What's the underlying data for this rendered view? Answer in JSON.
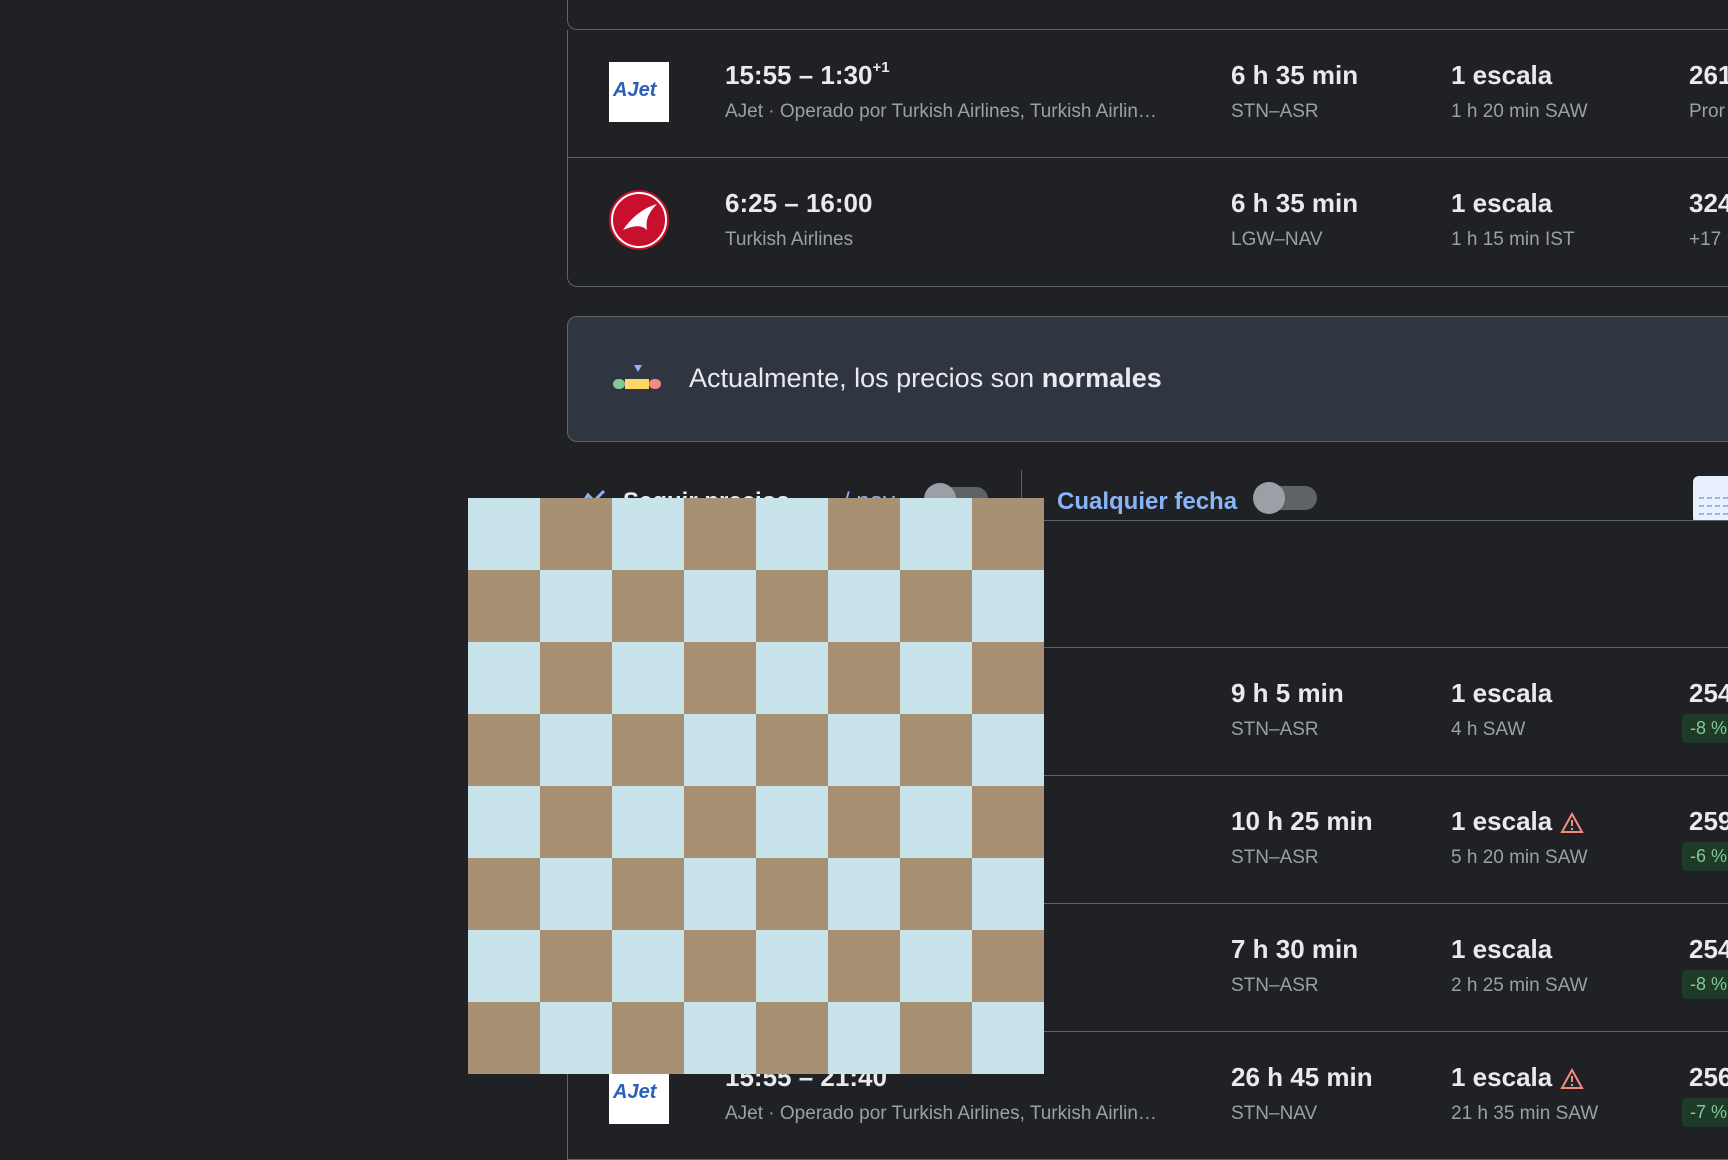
{
  "top_card": {
    "rows": [
      {
        "times": "15:55 – 1:30",
        "times_suffix": "+1",
        "airline": "AJet · Operado por Turkish Airlines, Turkish Airlin…",
        "duration": "6 h 35 min",
        "route": "STN–ASR",
        "stops": "1 escala",
        "stop_detail": "1 h 20 min SAW",
        "price": "261",
        "price_sub": "Pror",
        "logo": "ajet-logo",
        "logo_text": "AJet"
      },
      {
        "times": "6:25 – 16:00",
        "airline": "Turkish Airlines",
        "duration": "6 h 35 min",
        "route": "LGW–NAV",
        "stops": "1 escala",
        "stop_detail": "1 h 15 min IST",
        "price": "324",
        "price_sub": "+17",
        "logo": "turkish-airlines-logo"
      }
    ]
  },
  "price_banner": {
    "text_prefix": "Actualmente, los precios son ",
    "text_bold": "normales"
  },
  "controls": {
    "track_prices_label": "Seguir precios",
    "track_suffix": "/ nov",
    "any_date_label": "Cualquier fecha"
  },
  "bottom_card": {
    "rows": [
      {
        "duration": "9 h 5 min",
        "route": "STN–ASR",
        "stops": "1 escala",
        "stop_detail": "4 h SAW",
        "price": "254",
        "badge": "-8 %",
        "warning": false
      },
      {
        "duration": "10 h 25 min",
        "route": "STN–ASR",
        "stops": "1 escala",
        "stop_detail": "5 h 20 min SAW",
        "price": "259",
        "badge": "-6 %",
        "warning": true
      },
      {
        "duration": "7 h 30 min",
        "route": "STN–ASR",
        "stops": "1 escala",
        "stop_detail": "2 h 25 min SAW",
        "price": "254",
        "badge": "-8 %",
        "warning": false
      },
      {
        "times": "15:55 – 21:40",
        "airline": "AJet · Operado por Turkish Airlines, Turkish Airlin…",
        "duration": "26 h 45 min",
        "route": "STN–NAV",
        "stops": "1 escala",
        "stop_detail": "21 h 35 min SAW",
        "price": "256",
        "badge": "-7 %",
        "warning": true,
        "logo_text": "AJet"
      }
    ]
  },
  "colors": {
    "background": "#202124",
    "card_border": "#5f6368",
    "banner_bg": "#303542",
    "link_blue": "#8ab4f8",
    "badge_bg": "#1e3a29",
    "badge_text": "#81c995",
    "warning": "#f28b82",
    "checker_light": "#c8e4ea",
    "checker_dark": "#a89172"
  }
}
